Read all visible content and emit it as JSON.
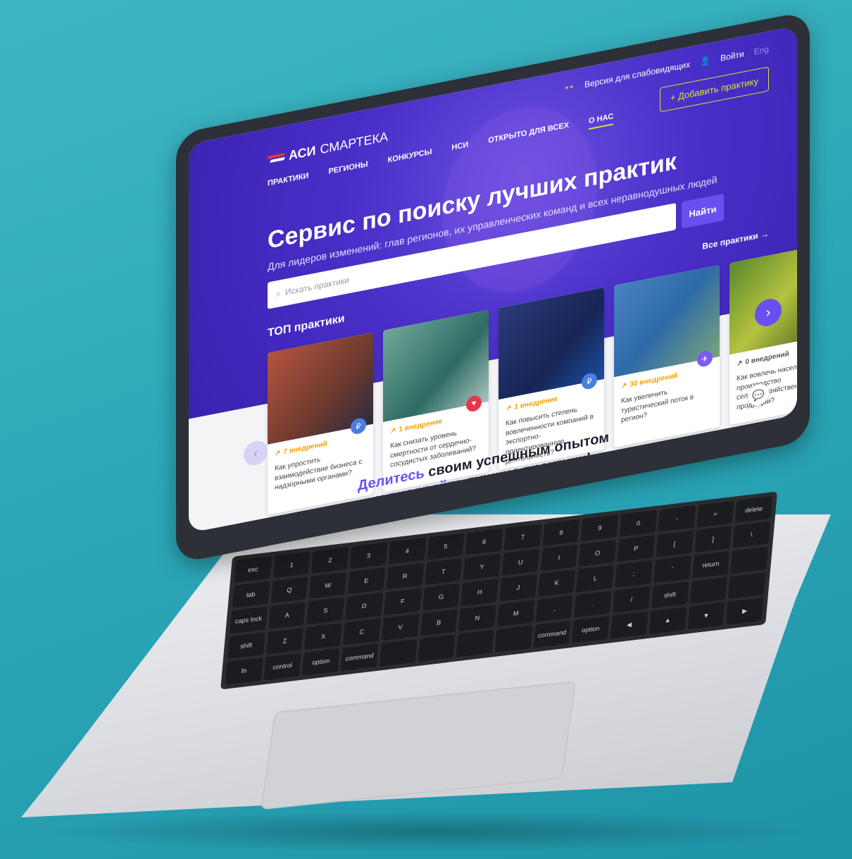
{
  "header": {
    "low_vision": "Версия для слабовидящих",
    "login": "Войти",
    "lang": "Eng",
    "add_practice": "+ Добавить практику"
  },
  "logo": {
    "asi": "АСИ",
    "smarteka": "СМАРТЕКА"
  },
  "nav": [
    {
      "label": "ПРАКТИКИ"
    },
    {
      "label": "РЕГИОНЫ"
    },
    {
      "label": "КОНКУРСЫ"
    },
    {
      "label": "НСИ"
    },
    {
      "label": "ОТКРЫТО ДЛЯ ВСЕХ"
    },
    {
      "label": "О НАС"
    }
  ],
  "hero": {
    "title": "Сервис по поиску лучших практик",
    "subtitle": "Для лидеров изменений: глав регионов, их управленческих команд и всех неравнодушных людей",
    "search_placeholder": "Искать практики",
    "search_button": "Найти",
    "all_practices": "Все практики →",
    "top_label": "ТОП практики"
  },
  "cards": [
    {
      "badge": "7 внедрений",
      "text": "Как упростить взаимодействие бизнеса с надзорными органами?",
      "icon": "₽"
    },
    {
      "badge": "1 внедрение",
      "text": "Как снизать уровень смертности от сердечно-сосудистых заболеваний?",
      "icon": "♥"
    },
    {
      "badge": "1 внедрение",
      "text": "Как повысить степень вовлеченности компаний в экспортно-ориентированную деятельность?",
      "icon": "₽"
    },
    {
      "badge": "30 внедрений",
      "text": "Как увеличить туристический поток в регион?",
      "icon": "✈"
    },
    {
      "badge": "0 внедрений",
      "text": "Как вовлечь население в производство сельскохозяйственной продукции?",
      "icon": "☐"
    }
  ],
  "slogan": {
    "line1_accent": "Делитесь",
    "line1_rest": " своим успешным опытом",
    "line2_pre": "и ",
    "line2_accent": "внедряйте",
    "line2_rest": " лучшие практики!"
  },
  "keyboard": {
    "keys": [
      "esc",
      "1",
      "2",
      "3",
      "4",
      "5",
      "6",
      "7",
      "8",
      "9",
      "0",
      "-",
      "=",
      "delete",
      "tab",
      "Q",
      "W",
      "E",
      "R",
      "T",
      "Y",
      "U",
      "I",
      "O",
      "P",
      "[",
      "]",
      "\\",
      "caps lock",
      "A",
      "S",
      "D",
      "F",
      "G",
      "H",
      "J",
      "K",
      "L",
      ";",
      "'",
      "return",
      "",
      "shift",
      "Z",
      "X",
      "C",
      "V",
      "B",
      "N",
      "M",
      ",",
      ".",
      "/",
      "shift",
      "",
      "",
      "fn",
      "control",
      "option",
      "command",
      "",
      "",
      "",
      "",
      "command",
      "option",
      "◀",
      "▲",
      "▼",
      "▶"
    ]
  }
}
